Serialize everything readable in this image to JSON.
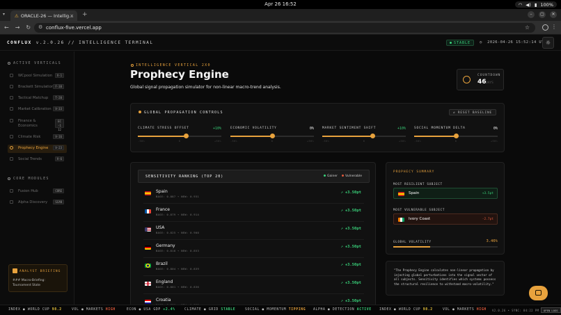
{
  "os": {
    "date": "Apr 26  16:52",
    "battery": "100%"
  },
  "browser": {
    "tab_title": "ORACLE-26 — Intellig...",
    "url": "conflux-five.vercel.app"
  },
  "header": {
    "brand": "CONFLUX",
    "brand_tail": "v.2.0.26 // INTELLIGENCE TERMINAL",
    "status": "STABLE",
    "timestamp": "2026-04-26 15:52:14 UTC"
  },
  "sidebar": {
    "active_label": "ACTIVE VERTICALS",
    "items": [
      {
        "label": "WCpool Simulation",
        "badge": "V-1"
      },
      {
        "label": "Brackett Simulation",
        "badge": "F-38"
      },
      {
        "label": "Tactical Matchup",
        "badge": "T-20"
      },
      {
        "label": "Market Calibration",
        "badge": "V-33"
      },
      {
        "label": "Finance & Economics",
        "badge": "EC-112"
      },
      {
        "label": "Climate Risk",
        "badge": "V-16"
      },
      {
        "label": "Prophecy Engine",
        "badge": "V-23"
      },
      {
        "label": "Social Trends",
        "badge": "V-6"
      }
    ],
    "core_label": "CORE MODULES",
    "core_items": [
      {
        "label": "Fusion Hub",
        "badge": "CORE"
      },
      {
        "label": "Alpha Discovery",
        "badge": "SCAN"
      }
    ],
    "briefing_title": "ANALYST BRIEFING",
    "briefing_text": "### Macro-Briefing: Tournament State"
  },
  "page": {
    "eyebrow": "INTELLIGENCE VERTICAL 2X0",
    "title": "Prophecy Engine",
    "subtitle": "Global signal propagation simulator for non-linear macro-trend analysis.",
    "countdown_label": "COUNTDOWN",
    "countdown_value": "46",
    "countdown_unit": "DAYS"
  },
  "controls": {
    "title": "GLOBAL PROPAGATION CONTROLS",
    "reset_label": "RESET BASELINE",
    "sliders": [
      {
        "label": "CLIMATE STRESS OFFSET",
        "value": "+10%",
        "level": 0.58,
        "min": "-50%",
        "mid": "0",
        "max": "+50%"
      },
      {
        "label": "ECONOMIC VOLATILITY",
        "value": "0%",
        "level": 0.5,
        "min": "-50%",
        "mid": "0",
        "max": "+50%"
      },
      {
        "label": "MARKET SENTIMENT SHIFT",
        "value": "+10%",
        "level": 0.6,
        "min": "-50%",
        "mid": "0",
        "max": "+50%"
      },
      {
        "label": "SOCIAL MOMENTUM DELTA",
        "value": "0%",
        "level": 0.5,
        "min": "-50%",
        "mid": "0",
        "max": "+50%"
      }
    ]
  },
  "ranking": {
    "title": "SENSITIVITY RANKING (TOP 20)",
    "legend_gainer": "Gainer",
    "legend_vulnerable": "Vulnerable",
    "rows": [
      {
        "name": "Spain",
        "meta": "BASE: 0.887 → NEW: 0.931",
        "delta": "+3.50pt",
        "flag": "spain"
      },
      {
        "name": "France",
        "meta": "BASE: 0.879 → NEW: 0.914",
        "delta": "+3.50pt",
        "flag": "france"
      },
      {
        "name": "USA",
        "meta": "BASE: 0.825 → NEW: 0.900",
        "delta": "+3.50pt",
        "flag": "usa"
      },
      {
        "name": "Germany",
        "meta": "BASE: 0.818 → NEW: 0.853",
        "delta": "+3.50pt",
        "flag": "germany"
      },
      {
        "name": "Brazil",
        "meta": "BASE: 0.804 → NEW: 0.839",
        "delta": "+3.50pt",
        "flag": "brazil"
      },
      {
        "name": "England",
        "meta": "BASE: 0.801 → NEW: 0.836",
        "delta": "+3.50pt",
        "flag": "england"
      },
      {
        "name": "Croatia",
        "meta": "BASE: 0.790 → NEW: 0.825",
        "delta": "+3.50pt",
        "flag": "croatia"
      }
    ]
  },
  "summary": {
    "title": "PROPHECY SUMMARY",
    "resilient_label": "MOST RESILIENT SUBJECT",
    "resilient_name": "Spain",
    "resilient_value": "+3.5pt",
    "vulnerable_label": "MOST VULNERABLE SUBJECT",
    "vulnerable_name": "Ivory Coast",
    "vulnerable_value": "-2.7pt",
    "volatility_label": "GLOBAL VOLATILITY",
    "volatility_value": "3.46%",
    "volatility_level": 0.35
  },
  "quote": "\"The Prophecy Engine calculates non-linear propagation by injecting global perturbations into the signal vector of all subjects. Sensitivity identifies which systems possess the structural resilience to withstand macro-volatility.\"",
  "ticker": {
    "items": [
      {
        "label": "INDEX ● WORLD CUP",
        "value": "98.2",
        "color": "#e8c43d"
      },
      {
        "label": "VOL ● MARKETS",
        "value": "HIGH",
        "color": "#e05a3c"
      },
      {
        "label": "ECON ● USA GDP",
        "value": "+2.4%",
        "color": "#39d27a"
      },
      {
        "label": "CLIMATE ● GRID",
        "value": "STABLE",
        "color": "#39d27a"
      },
      {
        "label": "SOCIAL ● MOMENTUM",
        "value": "TIPPING",
        "color": "#e8a23d"
      },
      {
        "label": "ALPHA ● DETECTION",
        "value": "ACTIVE",
        "color": "#39d27a"
      },
      {
        "label": "INDEX ● WORLD CUP",
        "value": "98.2",
        "color": "#e8c43d"
      },
      {
        "label": "VOL ● MARKETS",
        "value": "HIGH",
        "color": "#e05a3c"
      }
    ],
    "system": "V2.0.26 • SYNC: 04:22 PM",
    "open_label": "OPEN LOGS"
  },
  "colors": {
    "accent": "#e8a23d",
    "gain": "#39d27a",
    "loss": "#e05a3c"
  }
}
